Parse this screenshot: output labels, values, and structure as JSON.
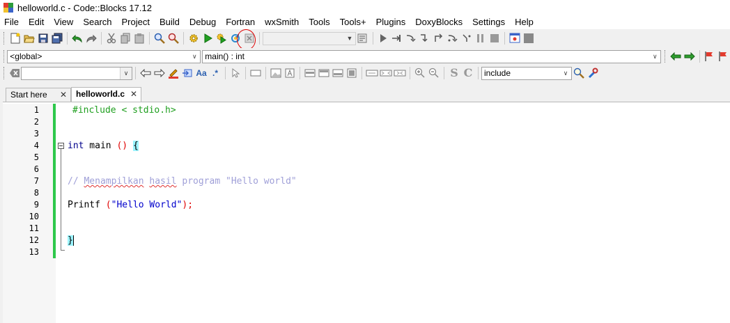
{
  "window": {
    "title": "helloworld.c - Code::Blocks 17.12"
  },
  "menu": [
    "File",
    "Edit",
    "View",
    "Search",
    "Project",
    "Build",
    "Debug",
    "Fortran",
    "wxSmith",
    "Tools",
    "Tools+",
    "Plugins",
    "DoxyBlocks",
    "Settings",
    "Help"
  ],
  "toolbar1": {
    "icons": [
      "new-file-icon",
      "open-file-icon",
      "save-icon",
      "save-all-icon",
      "undo-icon",
      "redo-icon",
      "cut-icon",
      "copy-icon",
      "paste-icon",
      "find-icon",
      "replace-icon",
      "build-icon",
      "run-icon",
      "build-and-run-icon",
      "rebuild-icon",
      "abort-icon"
    ],
    "build_target": "",
    "debug_icons": [
      "debug-continue-icon",
      "run-to-cursor-icon",
      "next-line-icon",
      "step-into-icon",
      "step-out-icon",
      "next-instruction-icon",
      "step-into-instruction-icon",
      "break-debugger-icon",
      "stop-debugger-icon"
    ]
  },
  "toolbar2": {
    "scope": "<global>",
    "function": "main() : int"
  },
  "toolbar3": {
    "search_text": "",
    "include_search": "include"
  },
  "tabs": [
    {
      "label": "Start here",
      "active": false
    },
    {
      "label": "helloworld.c",
      "active": true
    }
  ],
  "editor": {
    "line_numbers": [
      "1",
      "2",
      "3",
      "4",
      "5",
      "6",
      "7",
      "8",
      "9",
      "10",
      "11",
      "12",
      "13"
    ],
    "lines": {
      "l1": "#include < stdio.h>",
      "l4_kw": "int",
      "l4_name": " main ",
      "l4_parens": "()",
      "l4_space": " ",
      "l4_brace": "{",
      "l7_prefix": "// ",
      "l7_word1": "Menampilkan",
      "l7_space1": " ",
      "l7_word2": "hasil",
      "l7_rest": " program \"Hello world\"",
      "l9_name": "Printf ",
      "l9_open": "(",
      "l9_str": "\"Hello World\"",
      "l9_close": ");",
      "l12_brace": "}"
    }
  },
  "colors": {
    "changebar": "#2ec84b",
    "brace_highlight": "#9cf5ff",
    "annotation_circle": "#e00000"
  }
}
